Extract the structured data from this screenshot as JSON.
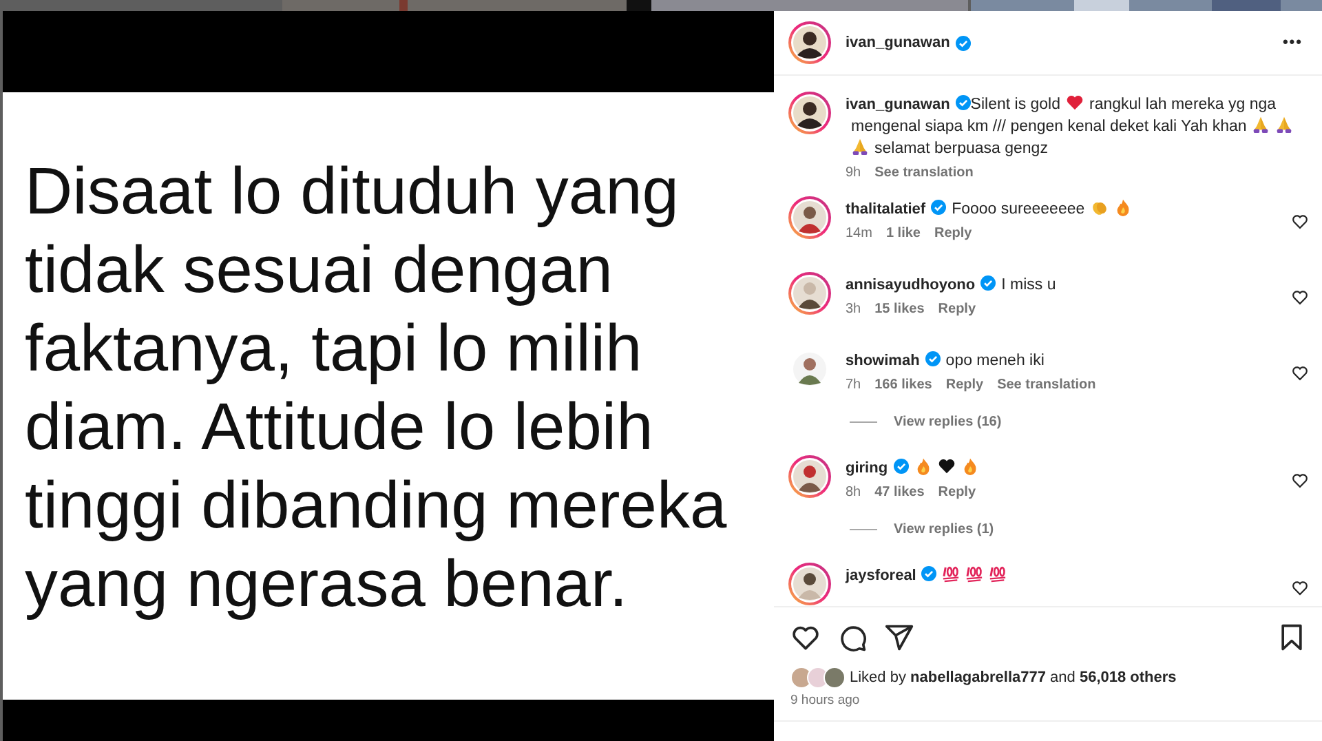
{
  "post": {
    "quote": "Disaat lo dituduh yang tidak sesuai dengan faktanya, tapi lo milih diam. Attitude lo lebih tinggi dibanding mereka yang ngerasa benar."
  },
  "header": {
    "user": "ivan_gunawan",
    "verified": true,
    "story_ring": true,
    "menu": "•••"
  },
  "caption": {
    "user": "ivan_gunawan",
    "verified": true,
    "story_ring": true,
    "body": [
      {
        "kind": "text",
        "text": "Silent is gold"
      },
      {
        "kind": "heart"
      },
      {
        "kind": "text",
        "text": "rangkul lah mereka yg nga"
      },
      {
        "kind": "text",
        "text": "mengenal siapa km /// pengen kenal deket kali Yah khan"
      },
      {
        "kind": "pray"
      },
      {
        "kind": "pray"
      },
      {
        "kind": "pray"
      },
      {
        "kind": "text",
        "text": "selamat berpuasa gengz"
      }
    ],
    "time": "9h",
    "actions": [
      "See translation"
    ]
  },
  "comments": [
    {
      "user": "thalitalatief",
      "verified": true,
      "story_ring": true,
      "body": [
        {
          "kind": "text",
          "text": "Foooo sureeeeeee"
        },
        {
          "kind": "clap"
        },
        {
          "kind": "fire"
        }
      ],
      "time": "14m",
      "likes": "1 like",
      "actions": [
        "Reply"
      ]
    },
    {
      "user": "annisayudhoyono",
      "verified": true,
      "story_ring": true,
      "body": [
        {
          "kind": "text",
          "text": "I miss u"
        }
      ],
      "time": "3h",
      "likes": "15 likes",
      "actions": [
        "Reply"
      ]
    },
    {
      "user": "showimah",
      "verified": true,
      "story_ring": false,
      "body": [
        {
          "kind": "text",
          "text": "opo meneh iki"
        }
      ],
      "time": "7h",
      "likes": "166 likes",
      "actions": [
        "Reply",
        "See translation"
      ],
      "view_replies": "View replies (16)"
    },
    {
      "user": "giring",
      "verified": true,
      "story_ring": true,
      "body": [
        {
          "kind": "fire"
        },
        {
          "kind": "blackheart"
        },
        {
          "kind": "fire"
        }
      ],
      "time": "8h",
      "likes": "47 likes",
      "actions": [
        "Reply"
      ],
      "view_replies": "View replies (1)"
    },
    {
      "user": "jaysforeal",
      "verified": true,
      "story_ring": true,
      "body": [
        {
          "kind": "hundred"
        },
        {
          "kind": "hundred"
        },
        {
          "kind": "hundred"
        }
      ]
    }
  ],
  "likes": {
    "text": "Liked by **nabellagabrella777** and **56,018 others**"
  },
  "posted": "9 hours ago"
}
